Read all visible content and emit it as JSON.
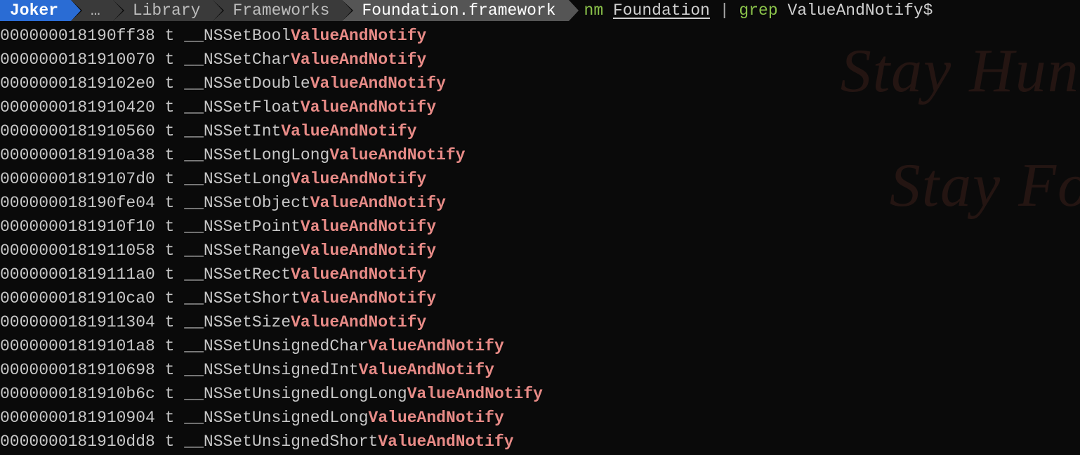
{
  "breadcrumb": {
    "host": "Joker",
    "ellipsis": "…",
    "items": [
      "Library",
      "Frameworks",
      "Foundation.framework"
    ]
  },
  "command": {
    "nm": "nm",
    "nm_arg": "Foundation",
    "pipe": "|",
    "grep": "grep",
    "grep_arg": "ValueAndNotify$"
  },
  "watermark": {
    "line1": "Stay Hun",
    "line2": "Stay Foo"
  },
  "output": [
    {
      "addr": "000000018190ff38",
      "type": "t",
      "prefix": "__NSSetBool",
      "match": "ValueAndNotify"
    },
    {
      "addr": "0000000181910070",
      "type": "t",
      "prefix": "__NSSetChar",
      "match": "ValueAndNotify"
    },
    {
      "addr": "00000001819102e0",
      "type": "t",
      "prefix": "__NSSetDouble",
      "match": "ValueAndNotify"
    },
    {
      "addr": "0000000181910420",
      "type": "t",
      "prefix": "__NSSetFloat",
      "match": "ValueAndNotify"
    },
    {
      "addr": "0000000181910560",
      "type": "t",
      "prefix": "__NSSetInt",
      "match": "ValueAndNotify"
    },
    {
      "addr": "0000000181910a38",
      "type": "t",
      "prefix": "__NSSetLongLong",
      "match": "ValueAndNotify"
    },
    {
      "addr": "00000001819107d0",
      "type": "t",
      "prefix": "__NSSetLong",
      "match": "ValueAndNotify"
    },
    {
      "addr": "000000018190fe04",
      "type": "t",
      "prefix": "__NSSetObject",
      "match": "ValueAndNotify"
    },
    {
      "addr": "0000000181910f10",
      "type": "t",
      "prefix": "__NSSetPoint",
      "match": "ValueAndNotify"
    },
    {
      "addr": "0000000181911058",
      "type": "t",
      "prefix": "__NSSetRange",
      "match": "ValueAndNotify"
    },
    {
      "addr": "00000001819111a0",
      "type": "t",
      "prefix": "__NSSetRect",
      "match": "ValueAndNotify"
    },
    {
      "addr": "0000000181910ca0",
      "type": "t",
      "prefix": "__NSSetShort",
      "match": "ValueAndNotify"
    },
    {
      "addr": "0000000181911304",
      "type": "t",
      "prefix": "__NSSetSize",
      "match": "ValueAndNotify"
    },
    {
      "addr": "00000001819101a8",
      "type": "t",
      "prefix": "__NSSetUnsignedChar",
      "match": "ValueAndNotify"
    },
    {
      "addr": "0000000181910698",
      "type": "t",
      "prefix": "__NSSetUnsignedInt",
      "match": "ValueAndNotify"
    },
    {
      "addr": "0000000181910b6c",
      "type": "t",
      "prefix": "__NSSetUnsignedLongLong",
      "match": "ValueAndNotify"
    },
    {
      "addr": "0000000181910904",
      "type": "t",
      "prefix": "__NSSetUnsignedLong",
      "match": "ValueAndNotify"
    },
    {
      "addr": "0000000181910dd8",
      "type": "t",
      "prefix": "__NSSetUnsignedShort",
      "match": "ValueAndNotify"
    }
  ]
}
